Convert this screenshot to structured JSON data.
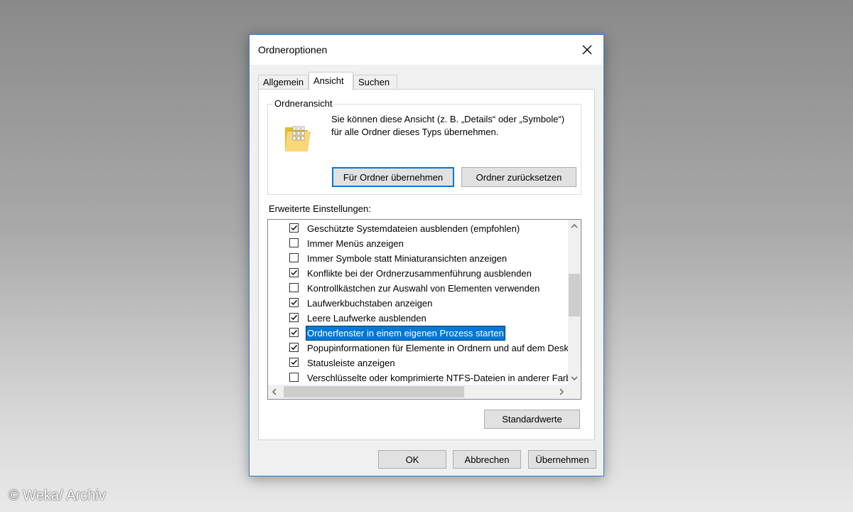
{
  "window": {
    "title": "Ordneroptionen"
  },
  "tabs": [
    {
      "label": "Allgemein",
      "active": false
    },
    {
      "label": "Ansicht",
      "active": true
    },
    {
      "label": "Suchen",
      "active": false
    }
  ],
  "folder_view": {
    "group_label": "Ordneransicht",
    "description": "Sie können diese Ansicht (z. B. „Details“ oder „Symbole“) für alle Ordner dieses Typs übernehmen.",
    "apply_button": "Für Ordner übernehmen",
    "reset_button": "Ordner zurücksetzen"
  },
  "advanced": {
    "label": "Erweiterte Einstellungen:",
    "items": [
      {
        "label": "Geschützte Systemdateien ausblenden (empfohlen)",
        "checked": true
      },
      {
        "label": "Immer Menüs anzeigen",
        "checked": false
      },
      {
        "label": "Immer Symbole statt Miniaturansichten anzeigen",
        "checked": false
      },
      {
        "label": "Konflikte bei der Ordnerzusammenführung ausblenden",
        "checked": true
      },
      {
        "label": "Kontrollkästchen zur Auswahl von Elementen verwenden",
        "checked": false
      },
      {
        "label": "Laufwerkbuchstaben anzeigen",
        "checked": true
      },
      {
        "label": "Leere Laufwerke ausblenden",
        "checked": true
      },
      {
        "label": "Ordnerfenster in einem eigenen Prozess starten",
        "checked": true,
        "selected": true
      },
      {
        "label": "Popupinformationen für Elemente in Ordnern und auf dem Desktop anzeigen",
        "checked": true
      },
      {
        "label": "Statusleiste anzeigen",
        "checked": true
      },
      {
        "label": "Verschlüsselte oder komprimierte NTFS-Dateien in anderer Farbe anzeigen",
        "checked": false
      }
    ],
    "defaults_button": "Standardwerte"
  },
  "footer": {
    "ok": "OK",
    "cancel": "Abbrechen",
    "apply": "Übernehmen"
  },
  "watermark": "© Weka/ Archiv",
  "colors": {
    "accent": "#0078d7",
    "border": "#2b7ac9"
  }
}
